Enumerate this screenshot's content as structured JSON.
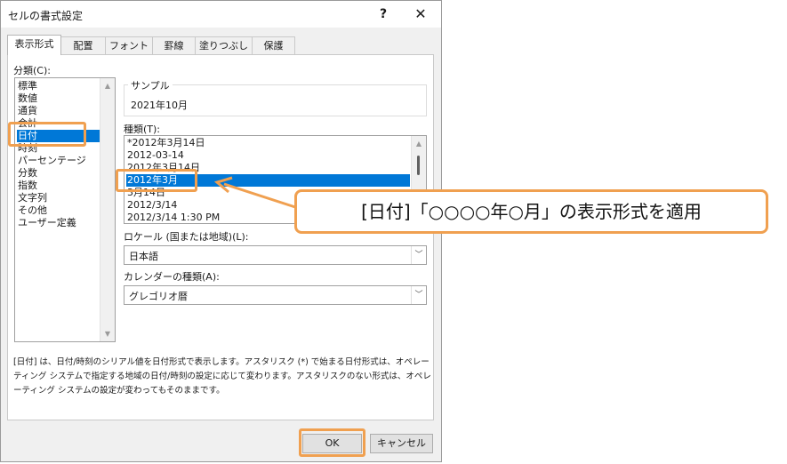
{
  "window": {
    "title": "セルの書式設定",
    "help": "?",
    "close": "✕"
  },
  "tabs": [
    "表示形式",
    "配置",
    "フォント",
    "罫線",
    "塗りつぶし",
    "保護"
  ],
  "category": {
    "label": "分類(C):",
    "items": [
      "標準",
      "数値",
      "通貨",
      "会計",
      "日付",
      "時刻",
      "パーセンテージ",
      "分数",
      "指数",
      "文字列",
      "その他",
      "ユーザー定義"
    ],
    "selected": "日付"
  },
  "sample": {
    "label": "サンプル",
    "value": "2021年10月"
  },
  "type": {
    "label": "種類(T):",
    "items": [
      "*2012年3月14日",
      "2012-03-14",
      "2012年3月14日",
      "2012年3月",
      "3月14日",
      "2012/3/14",
      "2012/3/14 1:30 PM"
    ],
    "selected": "2012年3月"
  },
  "locale": {
    "label": "ロケール (国または地域)(L):",
    "value": "日本語"
  },
  "calendar": {
    "label": "カレンダーの種類(A):",
    "value": "グレゴリオ暦"
  },
  "description": "[日付] は、日付/時刻のシリアル値を日付形式で表示します。アスタリスク (*) で始まる日付形式は、オペレーティング システムで指定する地域の日付/時刻の設定に応じて変わります。アスタリスクのない形式は、オペレーティング システムの設定が変わってもそのままです。",
  "buttons": {
    "ok": "OK",
    "cancel": "キャンセル"
  },
  "annotation": {
    "text": "[日付]「○○○○年○月」の表示形式を適用"
  },
  "colors": {
    "accent_orange": "#f0a050",
    "selection_blue": "#0078d7"
  }
}
